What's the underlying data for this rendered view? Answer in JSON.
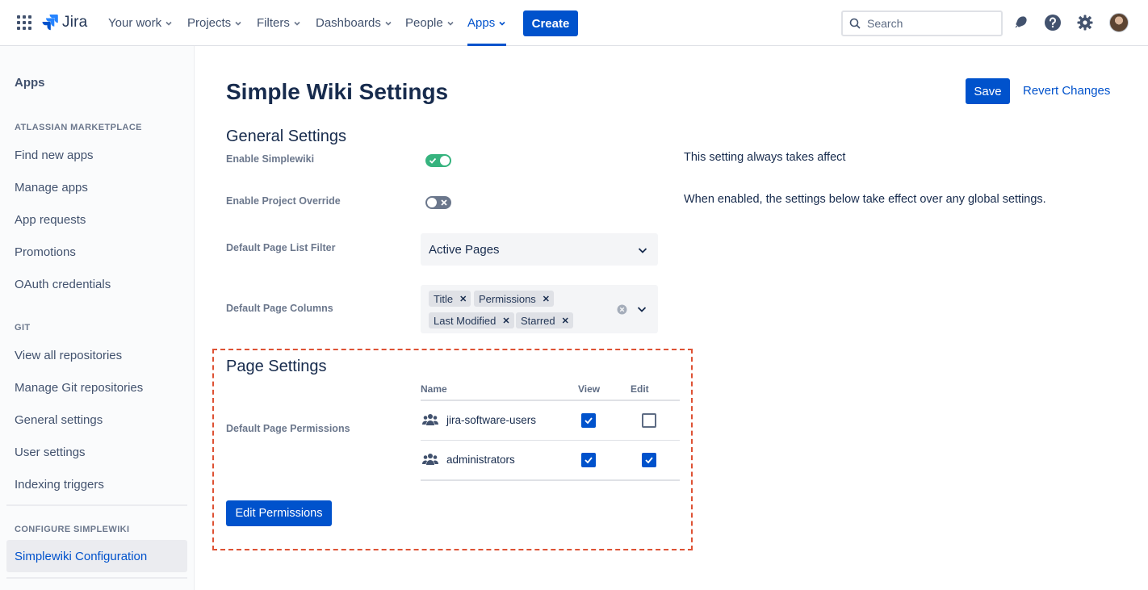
{
  "topnav": {
    "logo_text": "Jira",
    "items": [
      {
        "label": "Your work"
      },
      {
        "label": "Projects"
      },
      {
        "label": "Filters"
      },
      {
        "label": "Dashboards"
      },
      {
        "label": "People"
      },
      {
        "label": "Apps",
        "active": true
      }
    ],
    "create_label": "Create",
    "search_placeholder": "Search",
    "icons": [
      "app-switcher-icon",
      "notifications-icon",
      "help-icon",
      "settings-icon",
      "avatar"
    ]
  },
  "sidebar": {
    "title": "Apps",
    "sections": [
      {
        "heading": "ATLASSIAN MARKETPLACE",
        "items": [
          "Find new apps",
          "Manage apps",
          "App requests",
          "Promotions",
          "OAuth credentials"
        ]
      },
      {
        "heading": "GIT",
        "items": [
          "View all repositories",
          "Manage Git repositories",
          "General settings",
          "User settings",
          "Indexing triggers"
        ]
      },
      {
        "heading": "CONFIGURE SIMPLEWIKI",
        "items": [
          "Simplewiki Configuration"
        ],
        "selected": "Simplewiki Configuration"
      }
    ]
  },
  "main": {
    "title": "Simple Wiki Settings",
    "save_label": "Save",
    "revert_label": "Revert Changes",
    "general": {
      "title": "General Settings",
      "enable_simplewiki": {
        "label": "Enable Simplewiki",
        "value": true,
        "hint": "This setting always takes affect"
      },
      "enable_override": {
        "label": "Enable Project Override",
        "value": false,
        "hint": "When enabled, the settings below take effect over any global settings."
      },
      "list_filter": {
        "label": "Default Page List Filter",
        "value": "Active Pages"
      },
      "columns": {
        "label": "Default Page Columns",
        "tags": [
          "Title",
          "Permissions",
          "Last Modified",
          "Starred"
        ]
      }
    },
    "page_settings": {
      "title": "Page Settings",
      "permissions_label": "Default Page Permissions",
      "columns": {
        "name": "Name",
        "view": "View",
        "edit": "Edit"
      },
      "rows": [
        {
          "name": "jira-software-users",
          "view": true,
          "edit": false
        },
        {
          "name": "administrators",
          "view": true,
          "edit": true
        }
      ],
      "edit_button": "Edit Permissions"
    }
  },
  "colors": {
    "primary": "#0052cc",
    "toggle_on": "#36b37e",
    "highlight_dash": "#de5234"
  }
}
